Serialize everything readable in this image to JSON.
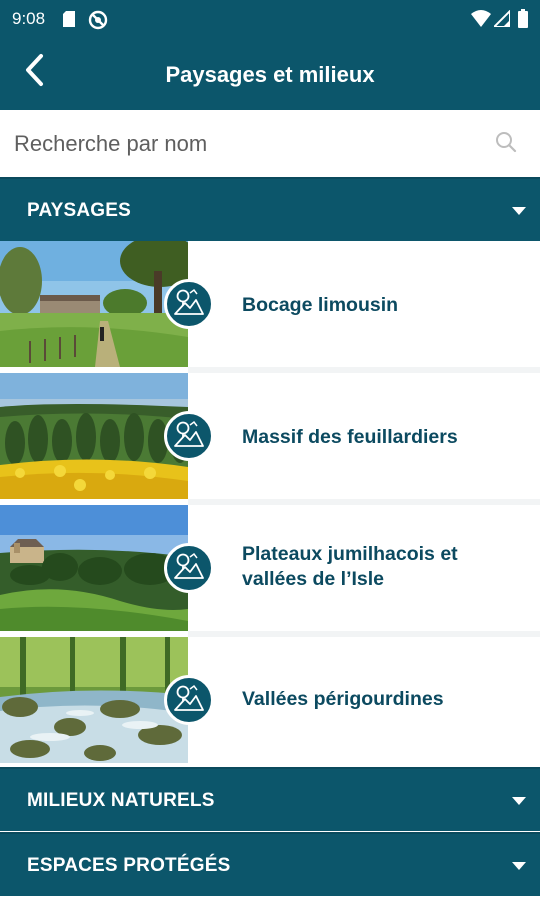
{
  "status_bar": {
    "time": "9:08",
    "icons": [
      "sd-card-icon",
      "no-disturb-icon",
      "wifi-icon",
      "signal-icon",
      "battery-icon"
    ]
  },
  "header": {
    "title": "Paysages et milieux",
    "back_icon": "chevron-left-icon"
  },
  "search": {
    "placeholder": "Recherche par nom",
    "icon": "search-icon"
  },
  "sections": [
    {
      "label": "PAYSAGES",
      "expanded": true,
      "items": [
        {
          "label": "Bocage limousin",
          "thumbnail": "hedged farmland with path",
          "badge_icon": "landscape-icon"
        },
        {
          "label": "Massif des feuillardiers",
          "thumbnail": "forested hills with yellow broom",
          "badge_icon": "landscape-icon"
        },
        {
          "label": "Plateaux jumilhacois et vallées de l’Isle",
          "thumbnail": "green valley with château",
          "badge_icon": "landscape-icon"
        },
        {
          "label": "Vallées périgourdines",
          "thumbnail": "rocky stream in forest",
          "badge_icon": "landscape-icon"
        }
      ]
    },
    {
      "label": "MILIEUX NATURELS",
      "expanded": false
    },
    {
      "label": "ESPACES PROTÉGÉS",
      "expanded": false
    }
  ],
  "colors": {
    "primary": "#0c566b",
    "item_text": "#0c4a60",
    "background": "#ffffff"
  }
}
